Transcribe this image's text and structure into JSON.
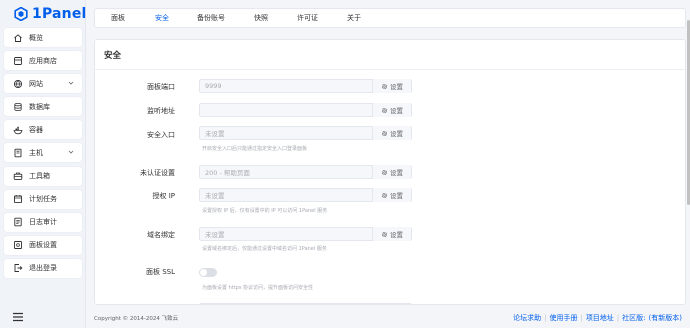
{
  "brand": {
    "name": "1Panel",
    "color": "#005eeb"
  },
  "sidebar": {
    "items": [
      {
        "label": "概览",
        "icon": "home-icon",
        "has_arrow": false
      },
      {
        "label": "应用商店",
        "icon": "app-store-icon",
        "has_arrow": false
      },
      {
        "label": "网站",
        "icon": "globe-icon",
        "has_arrow": true
      },
      {
        "label": "数据库",
        "icon": "database-icon",
        "has_arrow": false
      },
      {
        "label": "容器",
        "icon": "container-icon",
        "has_arrow": false
      },
      {
        "label": "主机",
        "icon": "host-icon",
        "has_arrow": true
      },
      {
        "label": "工具箱",
        "icon": "toolbox-icon",
        "has_arrow": false
      },
      {
        "label": "计划任务",
        "icon": "calendar-icon",
        "has_arrow": false
      },
      {
        "label": "日志审计",
        "icon": "log-icon",
        "has_arrow": false
      },
      {
        "label": "面板设置",
        "icon": "settings-icon",
        "has_arrow": false
      },
      {
        "label": "退出登录",
        "icon": "logout-icon",
        "has_arrow": false
      }
    ]
  },
  "tabs": [
    {
      "label": "面板",
      "active": false
    },
    {
      "label": "安全",
      "active": true
    },
    {
      "label": "备份账号",
      "active": false
    },
    {
      "label": "快照",
      "active": false
    },
    {
      "label": "许可证",
      "active": false
    },
    {
      "label": "关于",
      "active": false
    }
  ],
  "panel": {
    "title": "安全",
    "setting_label": "设置",
    "fields": {
      "port": {
        "label": "面板端口",
        "value": "9999"
      },
      "listen": {
        "label": "监听地址",
        "value": ""
      },
      "entrance": {
        "label": "安全入口",
        "value": "未设置",
        "help": "开启安全入口后只能通过指定安全入口登录面板"
      },
      "unauth": {
        "label": "未认证设置",
        "value": "200 - 帮助页面"
      },
      "allow_ip": {
        "label": "授权 IP",
        "value": "未设置",
        "help": "设置授权 IP 后，仅有设置中的 IP 可以访问 1Panel 服务"
      },
      "domain": {
        "label": "域名绑定",
        "value": "未设置",
        "help": "设置域名绑定后，仅能通过设置中域名访问 1Panel 服务"
      },
      "ssl": {
        "label": "面板 SSL",
        "enabled": false,
        "help": "为面板设置 https 协议访问，提升面板访问安全性"
      }
    }
  },
  "footer": {
    "copyright": "Copyright © 2014-2024 飞致云",
    "links": [
      "论坛求助",
      "使用手册",
      "项目地址"
    ],
    "community": "社区版:",
    "update": "(有新版本)"
  }
}
